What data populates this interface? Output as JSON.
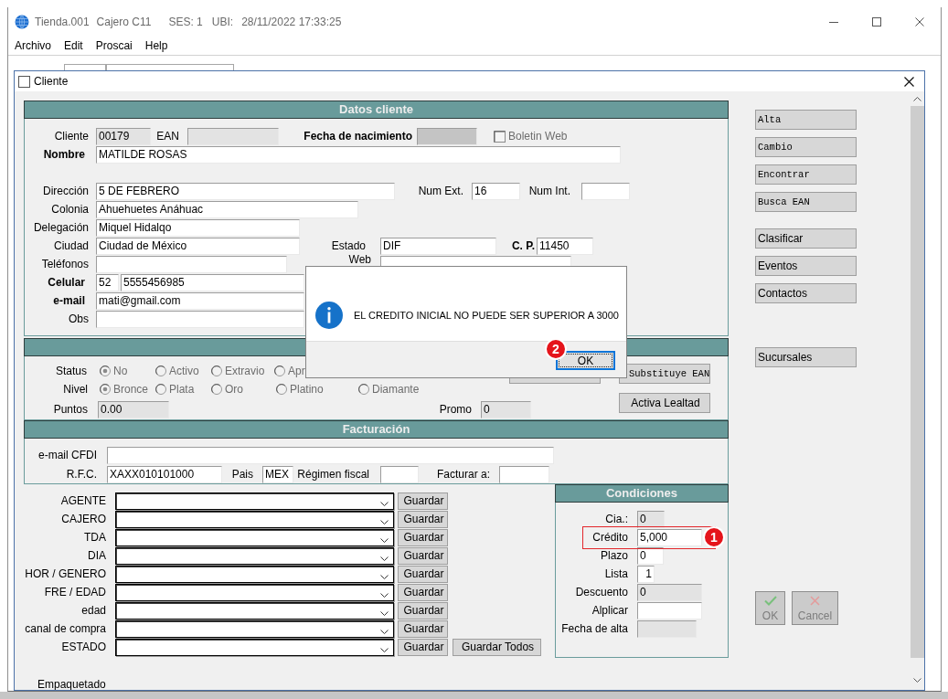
{
  "window": {
    "title_parts": [
      "Tienda.001",
      "Cajero C11",
      "SES: 1",
      "UBI:",
      "28/11/2022 17:33:25"
    ],
    "menu": [
      "Archivo",
      "Edit",
      "Proscai",
      "Help"
    ]
  },
  "cliente_window": {
    "title": "Cliente"
  },
  "datos_cliente": {
    "title": "Datos cliente",
    "cliente": {
      "label": "Cliente",
      "value": "00179",
      "disabled": true
    },
    "ean": {
      "label": "EAN",
      "disabled": true
    },
    "fecha_nacimiento": {
      "label": "Fecha de nacimiento",
      "disabled": true
    },
    "boletin_web": {
      "label": "Boletin Web",
      "checked": false,
      "disabled": true
    },
    "nombre": {
      "label": "Nombre",
      "value": "MATILDE ROSAS",
      "disabled": false
    },
    "direccion": {
      "label": "Dirección",
      "value": "5 DE FEBRERO",
      "disabled": false
    },
    "num_ext": {
      "label": "Num Ext.",
      "value": "16",
      "disabled": false
    },
    "num_int": {
      "label": "Num Int.",
      "disabled": false
    },
    "colonia": {
      "label": "Colonia",
      "value": "Ahuehuetes Anáhuac",
      "disabled": false
    },
    "delegacion": {
      "label": "Delegación",
      "value": "Miquel Hidalqo",
      "disabled": false
    },
    "ciudad": {
      "label": "Ciudad",
      "value": "Ciudad de México",
      "disabled": false
    },
    "estado": {
      "label": "Estado",
      "value": "DIF",
      "disabled": false
    },
    "cp": {
      "label": "C. P.",
      "value": "11450",
      "disabled": false
    },
    "telefonos": {
      "label": "Teléfonos",
      "disabled": false
    },
    "web": {
      "label": "Web",
      "disabled": false
    },
    "celular": {
      "label": "Celular",
      "prefix": "52",
      "value": "5555456985",
      "disabled": false
    },
    "email": {
      "label": "e-mail",
      "value": "mati@gmail.com",
      "disabled": false
    },
    "obs": {
      "label": "Obs",
      "disabled": false
    }
  },
  "lealtad": {
    "status": {
      "label": "Status",
      "disabled": true,
      "options": [
        {
          "label": "No",
          "selected": true
        },
        {
          "label": "Activo",
          "selected": false
        },
        {
          "label": "Extravio",
          "selected": false
        },
        {
          "label": "Apr",
          "selected": false
        }
      ]
    },
    "nivel": {
      "label": "Nivel",
      "disabled": true,
      "options": [
        {
          "label": "Bronce",
          "selected": true
        },
        {
          "label": "Plata",
          "selected": false
        },
        {
          "label": "Oro",
          "selected": false
        },
        {
          "label": "Platino",
          "selected": false
        },
        {
          "label": "Diamante",
          "selected": false
        }
      ]
    },
    "puntos": {
      "label": "Puntos",
      "value": "0.00",
      "disabled": true
    },
    "promo": {
      "label": "Promo",
      "value": "0",
      "disabled": true
    },
    "buttons": [
      {
        "label": "Substituye EAN"
      },
      {
        "label": "Activa Lealtad"
      }
    ]
  },
  "facturacion": {
    "title": "Facturación",
    "email_cfdi": {
      "label": "e-mail CFDI",
      "disabled": false
    },
    "rfc": {
      "label": "R.F.C.",
      "value": "XAXX010101000",
      "disabled": false
    },
    "pais": {
      "label": "Pais",
      "value": "MEX",
      "disabled": false
    },
    "regimen_fiscal": {
      "label": "Régimen fiscal",
      "disabled": false
    },
    "facturar_a": {
      "label": "Facturar a:",
      "disabled": false
    }
  },
  "clasificaciones": {
    "rows": [
      {
        "label": "AGENTE",
        "button": "Guardar"
      },
      {
        "label": "CAJERO",
        "button": "Guardar"
      },
      {
        "label": "TDA",
        "button": "Guardar"
      },
      {
        "label": "DIA",
        "button": "Guardar"
      },
      {
        "label": "HOR / GENERO",
        "button": "Guardar"
      },
      {
        "label": "FRE / EDAD",
        "button": "Guardar"
      },
      {
        "label": "edad",
        "button": "Guardar"
      },
      {
        "label": "canal de compra",
        "button": "Guardar"
      },
      {
        "label": "ESTADO",
        "button": "Guardar"
      }
    ],
    "save_all_button": "Guardar Todos"
  },
  "empaquetado": {
    "label": "Empaquetado"
  },
  "condiciones": {
    "title": "Condiciones",
    "fields": [
      {
        "label": "Cia.:",
        "value": "0",
        "disabled": true,
        "highlighted": false
      },
      {
        "label": "Crédito",
        "value": "5,000",
        "disabled": false,
        "highlighted": true,
        "badge": "1"
      },
      {
        "label": "Plazo",
        "value": "0",
        "disabled": false,
        "highlighted": false
      },
      {
        "label": "Lista",
        "value": "1",
        "disabled": false,
        "highlighted": false
      },
      {
        "label": "Descuento",
        "value": "0",
        "disabled": true,
        "highlighted": false
      },
      {
        "label": "Alplicar",
        "disabled": false,
        "highlighted": false
      },
      {
        "label": "Fecha de alta",
        "disabled": true,
        "highlighted": false
      }
    ]
  },
  "action_groups": [
    [
      {
        "label": "Alta"
      },
      {
        "label": "Cambio"
      },
      {
        "label": "Encontrar"
      },
      {
        "label": "Busca EAN"
      }
    ],
    [
      {
        "label": "Clasificar"
      },
      {
        "label": "Eventos"
      },
      {
        "label": "Contactos"
      }
    ],
    [
      {
        "label": "Sucursales"
      }
    ]
  ],
  "confirm_buttons": [
    {
      "kind": "ok",
      "label": "OK",
      "disabled": true
    },
    {
      "kind": "cancel",
      "label": "Cancel",
      "disabled": true
    }
  ],
  "message_dialog": {
    "kind": "info",
    "message": "EL CREDITO INICIAL NO PUEDE SER SUPERIOR A 3000",
    "ok_button": {
      "label": "OK",
      "focused": true,
      "badge": "2"
    }
  }
}
